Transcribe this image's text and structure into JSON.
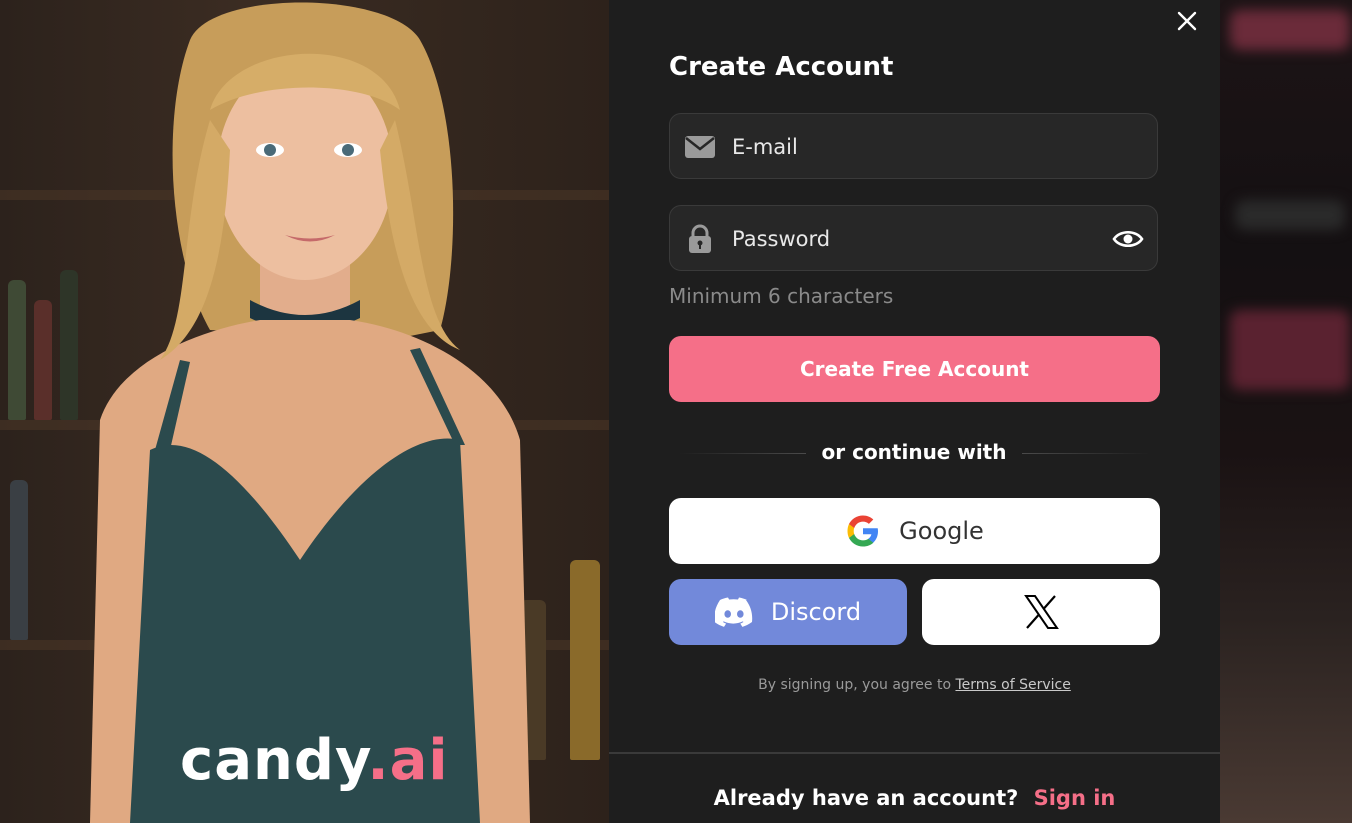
{
  "brand": {
    "logo_main": "candy",
    "logo_accent": ".ai",
    "accent_color": "#f56f88"
  },
  "modal": {
    "title": "Create Account",
    "email": {
      "placeholder": "E-mail",
      "icon": "envelope-icon"
    },
    "password": {
      "placeholder": "Password",
      "icon": "lock-icon",
      "toggle_icon": "eye-icon"
    },
    "password_hint": "Minimum 6 characters",
    "submit_label": "Create Free Account",
    "divider_text": "or continue with",
    "social": {
      "google_label": "Google",
      "discord_label": "Discord",
      "discord_color": "#7289da",
      "x_icon": "x-logo-icon"
    },
    "terms_prefix": "By signing up, you agree to",
    "terms_link": "Terms of Service",
    "signin_prompt": "Already have an account?",
    "signin_link": "Sign in",
    "close_icon": "close-icon"
  }
}
